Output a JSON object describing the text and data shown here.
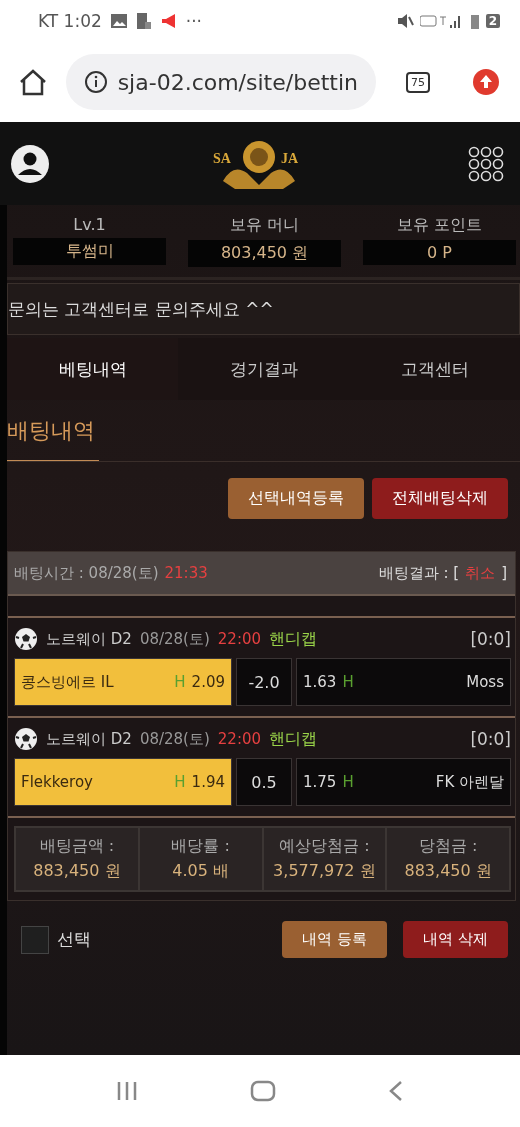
{
  "status_bar": {
    "carrier_time": "KT 1:02",
    "more": "···",
    "battery": "2"
  },
  "browser": {
    "url": "sja-02.com/site/bettin",
    "tab_count": "75"
  },
  "header": {
    "logo_left": "SA",
    "logo_right": "JA"
  },
  "stats": [
    {
      "label": "Lv.1",
      "value": "투썸미"
    },
    {
      "label": "보유 머니",
      "value": "803,450 원"
    },
    {
      "label": "보유 포인트",
      "value": "0 P"
    }
  ],
  "notice": "문의는 고객센터로 문의주세요 ^^",
  "nav": [
    {
      "label": "베팅내역",
      "selected": true
    },
    {
      "label": "경기결과",
      "selected": false
    },
    {
      "label": "고객센터",
      "selected": false
    }
  ],
  "page_title": "배팅내역",
  "top_buttons": [
    {
      "label": "선택내역등록",
      "kind": "brown"
    },
    {
      "label": "전체배팅삭제",
      "kind": "red"
    }
  ],
  "bet": {
    "time_label": "배팅시간 : 08/28(토)",
    "time": "21:33",
    "result_label": "배팅결과 : [",
    "result": "취소",
    "result_close": "]",
    "matches": [
      {
        "league": "노르웨이 D2",
        "date": "08/28(토)",
        "time": "22:00",
        "market": "핸디캡",
        "score": "[0:0]",
        "home": {
          "name": "콩스빙에르 IL",
          "marker": "H",
          "odds": "2.09",
          "selected": true
        },
        "line": "-2.0",
        "away": {
          "odds": "1.63",
          "marker": "H",
          "name": "Moss",
          "selected": false
        }
      },
      {
        "league": "노르웨이 D2",
        "date": "08/28(토)",
        "time": "22:00",
        "market": "핸디캡",
        "score": "[0:0]",
        "home": {
          "name": "Flekkeroy",
          "marker": "H",
          "odds": "1.94",
          "selected": true
        },
        "line": "0.5",
        "away": {
          "odds": "1.75",
          "marker": "H",
          "name": "FK 아렌달",
          "selected": false
        }
      }
    ],
    "summary": [
      {
        "label": "배팅금액 :",
        "value": "883,450 원"
      },
      {
        "label": "배당률 :",
        "value": "4.05 배"
      },
      {
        "label": "예상당첨금 :",
        "value": "3,577,972 원"
      },
      {
        "label": "당첨금 :",
        "value": "883,450 원"
      }
    ]
  },
  "footer": {
    "checkbox": {
      "label": "선택",
      "checked": false
    },
    "buttons": [
      {
        "label": "내역 등록",
        "kind": "brown"
      },
      {
        "label": "내역 삭제",
        "kind": "red"
      }
    ]
  }
}
